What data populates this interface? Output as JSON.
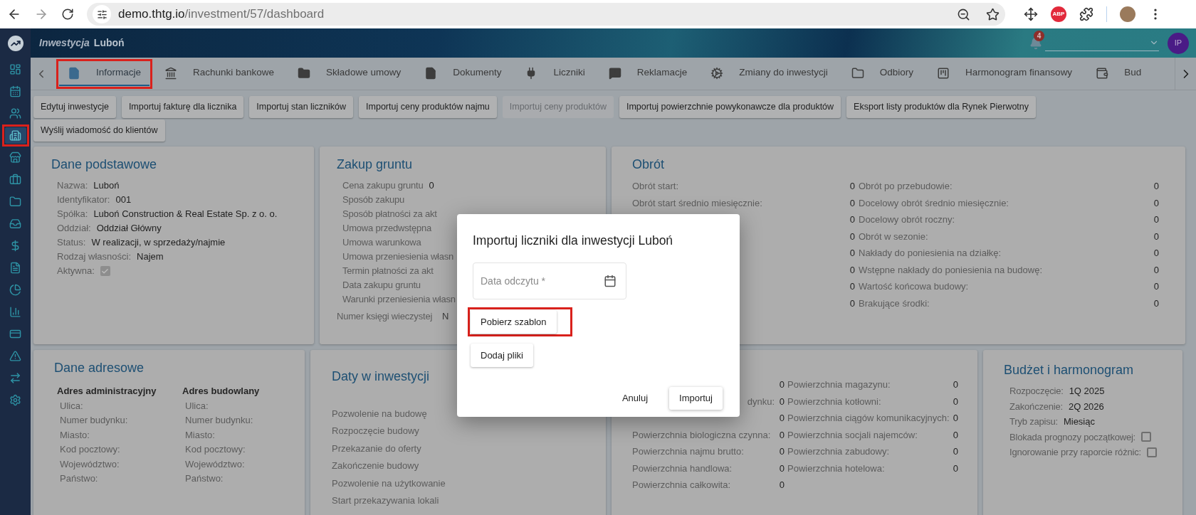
{
  "browser": {
    "url_host": "demo.thtg.io",
    "url_path": "/investment/57/dashboard",
    "abp_label": "ABP"
  },
  "header": {
    "section": "Inwestycja",
    "name": "Luboń",
    "notifications": "4",
    "avatar": "IP"
  },
  "sidebar": {
    "items": [
      {
        "selected": false,
        "highlighted": false
      },
      {
        "selected": false,
        "highlighted": false
      },
      {
        "selected": false,
        "highlighted": false
      },
      {
        "selected": true,
        "highlighted": true
      },
      {
        "selected": false,
        "highlighted": false
      },
      {
        "selected": false,
        "highlighted": false
      },
      {
        "selected": false,
        "highlighted": false
      },
      {
        "selected": false,
        "highlighted": false
      },
      {
        "selected": false,
        "highlighted": false
      },
      {
        "selected": false,
        "highlighted": false
      },
      {
        "selected": false,
        "highlighted": false
      },
      {
        "selected": false,
        "highlighted": false
      },
      {
        "selected": false,
        "highlighted": false
      },
      {
        "selected": false,
        "highlighted": false
      },
      {
        "selected": false,
        "highlighted": false
      },
      {
        "selected": false,
        "highlighted": false
      }
    ]
  },
  "tabs": {
    "items": [
      {
        "label": "Informacje",
        "selected": true,
        "highlighted": true
      },
      {
        "label": "Rachunki bankowe",
        "selected": false,
        "highlighted": false
      },
      {
        "label": "Składowe umowy",
        "selected": false,
        "highlighted": false
      },
      {
        "label": "Dokumenty",
        "selected": false,
        "highlighted": false
      },
      {
        "label": "Liczniki",
        "selected": false,
        "highlighted": false
      },
      {
        "label": "Reklamacje",
        "selected": false,
        "highlighted": false
      },
      {
        "label": "Zmiany do inwestycji",
        "selected": false,
        "highlighted": false
      },
      {
        "label": "Odbiory",
        "selected": false,
        "highlighted": false
      },
      {
        "label": "Harmonogram finansowy",
        "selected": false,
        "highlighted": false
      },
      {
        "label": "Bud",
        "selected": false,
        "highlighted": false
      }
    ]
  },
  "actions": [
    {
      "label": "Edytuj inwestycje",
      "disabled": false
    },
    {
      "label": "Importuj fakturę dla licznika",
      "disabled": false
    },
    {
      "label": "Importuj stan liczników",
      "disabled": false
    },
    {
      "label": "Importuj ceny produktów najmu",
      "disabled": false
    },
    {
      "label": "Importuj ceny produktów",
      "disabled": true
    },
    {
      "label": "Importuj powierzchnie powykonawcze dla produktów",
      "disabled": false
    },
    {
      "label": "Eksport listy produktów dla Rynek Pierwotny",
      "disabled": false
    },
    {
      "label": "Wyślij wiadomość do klientów",
      "disabled": false
    }
  ],
  "basic": {
    "title": "Dane podstawowe",
    "fields": [
      {
        "kind": "text",
        "label": "Nazwa:",
        "value": "Luboń"
      },
      {
        "kind": "text",
        "label": "Identyfikator:",
        "value": "001"
      },
      {
        "kind": "text",
        "label": "Spółka:",
        "value": "Luboń Construction & Real Estate Sp. z o. o."
      },
      {
        "kind": "text",
        "label": "Oddział:",
        "value": "Oddział Główny"
      },
      {
        "kind": "text",
        "label": "Status:",
        "value": "W realizacji, w sprzedaży/najmie"
      },
      {
        "kind": "text",
        "label": "Rodzaj własności:",
        "value": "Najem"
      },
      {
        "kind": "checkbox",
        "label": "Aktywna:",
        "checked": true
      }
    ]
  },
  "land": {
    "title": "Zakup gruntu",
    "fields": [
      {
        "label": "Cena zakupu gruntu",
        "value": "0"
      },
      {
        "label": "Sposób zakupu"
      },
      {
        "label": "Sposób płatności za akt"
      },
      {
        "label": "Umowa przedwstępna"
      },
      {
        "label": "Umowa warunkowa"
      },
      {
        "label": "Umowa przeniesienia własn"
      },
      {
        "label": "Termin płatności za akt"
      },
      {
        "label": "Data zakupu gruntu"
      },
      {
        "label": "Warunki przeniesienia własn"
      }
    ],
    "register": {
      "label": "Numer księgi wieczystej",
      "value": "N"
    }
  },
  "turnover": {
    "title": "Obrót",
    "left": [
      {
        "label": "Obrót start:",
        "value": "0"
      },
      {
        "label": "Obrót start średnio miesięcznie:",
        "value": "0"
      },
      {
        "value": "0"
      },
      {
        "value": "0"
      },
      {
        "value": "0"
      },
      {
        "value": "0"
      },
      {
        "value": "0"
      },
      {
        "value": "0"
      }
    ],
    "right": [
      {
        "label": "Obrót po przebudowie:",
        "value": "0"
      },
      {
        "label": "Docelowy obrót średnio miesięcznie:",
        "value": "0"
      },
      {
        "label": "Docelowy obrót roczny:",
        "value": "0"
      },
      {
        "label": "Obrót w sezonie:",
        "value": "0"
      },
      {
        "label": "Nakłady do poniesienia na działkę:",
        "value": "0"
      },
      {
        "label": "Wstępne nakłady do poniesienia na budowę:",
        "value": "0"
      },
      {
        "label": "Wartość końcowa budowy:",
        "value": "0"
      },
      {
        "label": "Brakujące środki:",
        "value": "0"
      }
    ]
  },
  "address": {
    "title": "Dane adresowe",
    "columns": [
      {
        "heading": "Adres administracyjny",
        "fields": [
          "Ulica:",
          "Numer budynku:",
          "Miasto:",
          "Kod pocztowy:",
          "Województwo:",
          "Państwo:"
        ]
      },
      {
        "heading": "Adres budowlany",
        "fields": [
          "Ulica:",
          "Numer budynku:",
          "Miasto:",
          "Kod pocztowy:",
          "Województwo:",
          "Państwo:"
        ]
      }
    ]
  },
  "dates": {
    "title": "Daty w inwestycji",
    "items": [
      "Pozwolenie na budowę",
      "Rozpoczęcie budowy",
      "Przekazanie do oferty",
      "Zakończenie budowy",
      "Pozwolenie na użytkowanie",
      "Start przekazywania lokali"
    ]
  },
  "areas": {
    "left": [
      {
        "value": "0"
      },
      {
        "label": "dynku:",
        "value": "0",
        "kind": "cut"
      },
      {
        "value": "0"
      },
      {
        "label": "Powierzchnia biologiczna czynna:",
        "value": "0"
      },
      {
        "label": "Powierzchnia najmu brutto:",
        "value": "0"
      },
      {
        "label": "Powierzchnia handlowa:",
        "value": "0"
      },
      {
        "label": "Powierzchnia całkowita:",
        "value": "0"
      }
    ],
    "right": [
      {
        "label": "Powierzchnia magazynu:",
        "value": "0"
      },
      {
        "label": "Powierzchnia kotłowni:",
        "value": "0"
      },
      {
        "label": "Powierzchnia ciągów komunikacyjnych:",
        "value": "0"
      },
      {
        "label": "Powierzchnia socjali najemców:",
        "value": "0"
      },
      {
        "label": "Powierzchnia zabudowy:",
        "value": "0"
      },
      {
        "label": "Powierzchnia hotelowa:",
        "value": "0"
      }
    ]
  },
  "budget": {
    "title": "Budżet i harmonogram",
    "fields": [
      {
        "kind": "text",
        "label": "Rozpoczęcie:",
        "value": "1Q 2025"
      },
      {
        "kind": "text",
        "label": "Zakończenie:",
        "value": "2Q 2026"
      },
      {
        "kind": "text",
        "label": "Tryb zapisu:",
        "value": "Miesiąc"
      },
      {
        "kind": "checkbox",
        "label": "Blokada prognozy początkowej:",
        "checked": false
      },
      {
        "kind": "checkbox",
        "label": "Ignorowanie przy raporcie różnic:",
        "checked": false
      }
    ]
  },
  "modal": {
    "title": "Importuj liczniki dla inwestycji Luboń",
    "date_field": {
      "placeholder": "Data odczytu *"
    },
    "buttons": [
      {
        "label": "Pobierz szablon",
        "highlighted": true
      },
      {
        "label": "Dodaj pliki",
        "highlighted": false
      }
    ],
    "footer": [
      {
        "label": "Anuluj",
        "kind": "text"
      },
      {
        "label": "Importuj",
        "kind": "raised"
      }
    ]
  }
}
